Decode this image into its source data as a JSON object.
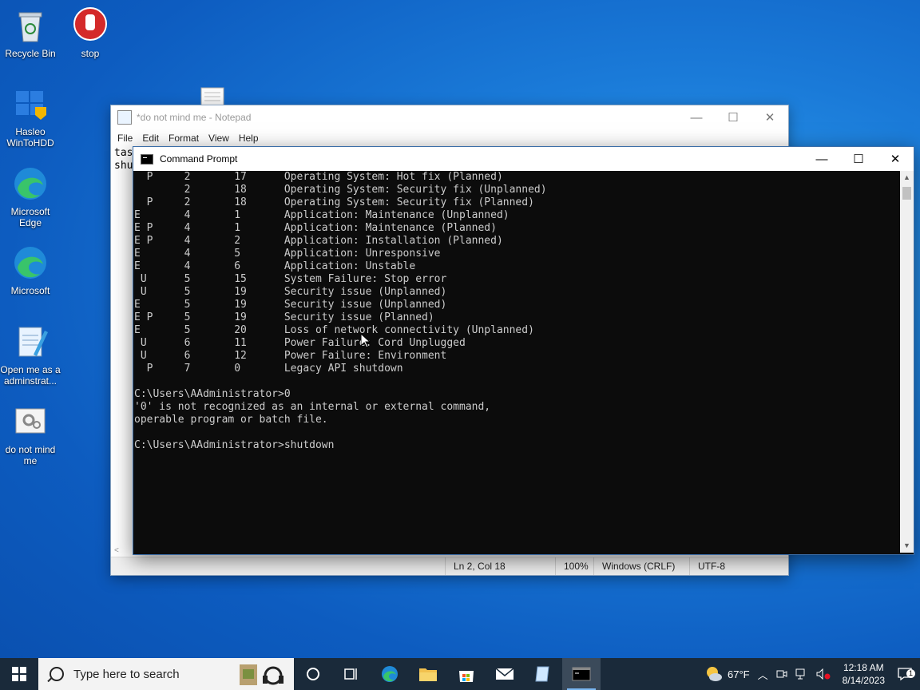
{
  "desktop": {
    "icons": [
      {
        "label": "Recycle Bin"
      },
      {
        "label": "stop"
      },
      {
        "label": "Hasleo WinToHDD"
      },
      {
        "label": "Microsoft Edge"
      },
      {
        "label": "Microsoft"
      },
      {
        "label": "Open me as a adminstrat..."
      },
      {
        "label": "do not mind me"
      }
    ]
  },
  "notepad": {
    "title": "*do not mind me - Notepad",
    "menu": [
      "File",
      "Edit",
      "Format",
      "View",
      "Help"
    ],
    "text_lines": [
      "tas",
      "shu"
    ],
    "status": {
      "position": "Ln 2, Col 18",
      "zoom": "100%",
      "line_endings": "Windows (CRLF)",
      "encoding": "UTF-8"
    },
    "controls": {
      "minimize": "—",
      "maximize": "☐",
      "close": "✕"
    }
  },
  "cmd": {
    "title": "Command Prompt",
    "controls": {
      "minimize": "—",
      "maximize": "☐",
      "close": "✕"
    },
    "lines": [
      "  P     2       17      Operating System: Hot fix (Planned)",
      "        2       18      Operating System: Security fix (Unplanned)",
      "  P     2       18      Operating System: Security fix (Planned)",
      "E       4       1       Application: Maintenance (Unplanned)",
      "E P     4       1       Application: Maintenance (Planned)",
      "E P     4       2       Application: Installation (Planned)",
      "E       4       5       Application: Unresponsive",
      "E       4       6       Application: Unstable",
      " U      5       15      System Failure: Stop error",
      " U      5       19      Security issue (Unplanned)",
      "E       5       19      Security issue (Unplanned)",
      "E P     5       19      Security issue (Planned)",
      "E       5       20      Loss of network connectivity (Unplanned)",
      " U      6       11      Power Failure: Cord Unplugged",
      " U      6       12      Power Failure: Environment",
      "  P     7       0       Legacy API shutdown",
      "",
      "C:\\Users\\AAdministrator>0",
      "'0' is not recognized as an internal or external command,",
      "operable program or batch file.",
      "",
      "C:\\Users\\AAdministrator>shutdown"
    ]
  },
  "taskbar": {
    "search_placeholder": "Type here to search",
    "weather": "67°F",
    "time": "12:18 AM",
    "date": "8/14/2023",
    "notification_count": "1"
  }
}
